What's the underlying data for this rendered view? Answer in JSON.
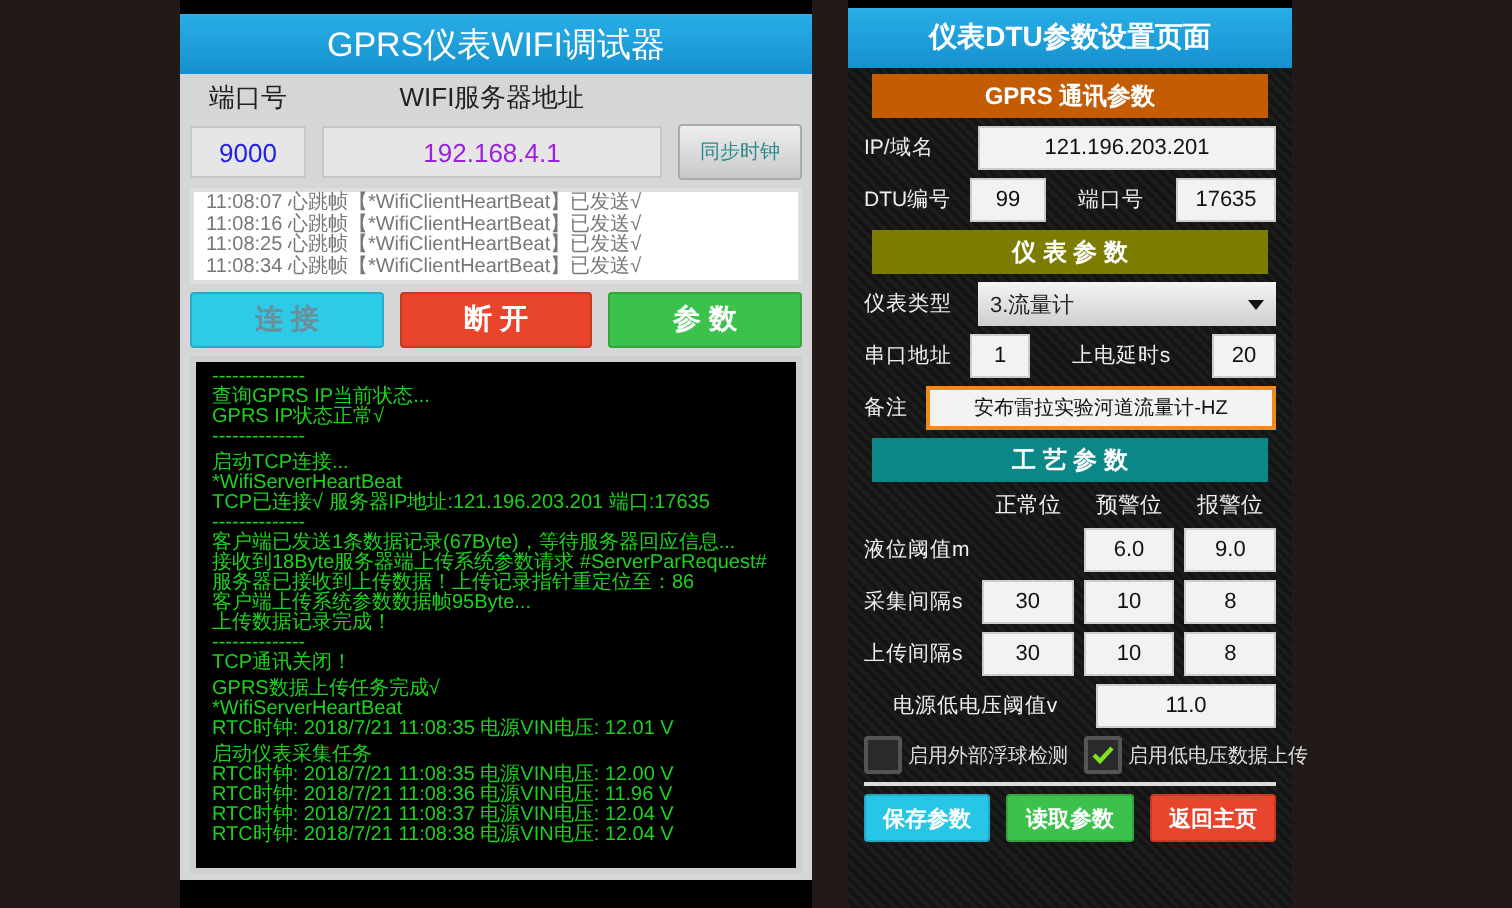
{
  "left_app": {
    "title": "GPRS仪表WIFI调试器",
    "port_label": "端口号",
    "server_label": "WIFI服务器地址",
    "port_value": "9000",
    "server_value": "192.168.4.1",
    "sync_button": "同步时钟",
    "log_lines": [
      "11:08:07 心跳帧【*WifiClientHeartBeat】已发送√",
      "11:08:16 心跳帧【*WifiClientHeartBeat】已发送√",
      "11:08:25 心跳帧【*WifiClientHeartBeat】已发送√",
      "11:08:34 心跳帧【*WifiClientHeartBeat】已发送√"
    ],
    "buttons": [
      {
        "label": "连 接",
        "kind": "connect",
        "disabled": true
      },
      {
        "label": "断 开",
        "kind": "disconnect",
        "disabled": false
      },
      {
        "label": "参 数",
        "kind": "params",
        "disabled": false
      }
    ],
    "console": [
      [
        "--------------",
        "查询GPRS IP当前状态...",
        "GPRS IP状态正常√",
        "--------------"
      ],
      [
        "启动TCP连接...",
        "*WifiServerHeartBeat",
        "TCP已连接√ 服务器IP地址:121.196.203.201 端口:17635",
        "--------------",
        "客户端已发送1条数据记录(67Byte)，等待服务器回应信息...",
        "接收到18Byte服务器端上传系统参数请求 #ServerParRequest#",
        "服务器已接收到上传数据！上传记录指针重定位至：86",
        "客户端上传系统参数数据帧95Byte...",
        "上传数据记录完成！",
        "--------------",
        "TCP通讯关闭！"
      ],
      [
        "GPRS数据上传任务完成√",
        "*WifiServerHeartBeat",
        "RTC时钟: 2018/7/21 11:08:35  电源VIN电压: 12.01 V"
      ],
      [
        "启动仪表采集任务",
        "RTC时钟: 2018/7/21 11:08:35  电源VIN电压: 12.00 V",
        "RTC时钟: 2018/7/21 11:08:36  电源VIN电压: 11.96 V",
        "RTC时钟: 2018/7/21 11:08:37  电源VIN电压: 12.04 V",
        "RTC时钟: 2018/7/21 11:08:38  电源VIN电压: 12.04 V"
      ]
    ]
  },
  "right_app": {
    "title": "仪表DTU参数设置页面",
    "gprs_header": "GPRS 通讯参数",
    "ip": {
      "label": "IP/域名",
      "value": "121.196.203.201"
    },
    "dtu": {
      "label": "DTU编号",
      "value": "99"
    },
    "port": {
      "label": "端口号",
      "value": "17635"
    },
    "meter_header": "仪 表 参 数",
    "meter_type": {
      "label": "仪表类型",
      "value": "3.流量计"
    },
    "serial": {
      "label": "串口地址",
      "value": "1"
    },
    "power_delay": {
      "label": "上电延时s",
      "value": "20"
    },
    "remark": {
      "label": "备注",
      "value": "安布雷拉实验河道流量计-HZ",
      "focused": true
    },
    "process_header": "工 艺 参 数",
    "process_columns": [
      "正常位",
      "预警位",
      "报警位"
    ],
    "process_rows": [
      {
        "label": "液位阈值m",
        "values": [
          "6.0",
          "9.0"
        ]
      },
      {
        "label": "采集间隔s",
        "values": [
          "30",
          "10",
          "8"
        ]
      },
      {
        "label": "上传间隔s",
        "values": [
          "30",
          "10",
          "8"
        ]
      }
    ],
    "low_voltage": {
      "label": "电源低电压阈值v",
      "value": "11.0"
    },
    "checkboxes": [
      {
        "label": "启用外部浮球检测",
        "checked": false
      },
      {
        "label": "启用低电压数据上传",
        "checked": true
      }
    ],
    "buttons": [
      {
        "label": "保存参数",
        "kind": "save"
      },
      {
        "label": "读取参数",
        "kind": "read"
      },
      {
        "label": "返回主页",
        "kind": "home"
      }
    ]
  }
}
